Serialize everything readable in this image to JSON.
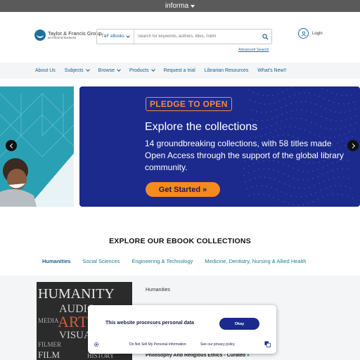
{
  "topbar": {
    "brand": "informa"
  },
  "header": {
    "logo_line1": "Taylor & Francis Group",
    "logo_line2": "an informa business",
    "search_scope": "T&F eBooks",
    "search_placeholder": "Search for keywords, authors, titles, ISBN",
    "advanced_search": "Advanced Search",
    "login": "Login"
  },
  "nav": {
    "items": [
      {
        "label": "About Us",
        "dropdown": false
      },
      {
        "label": "Subjects",
        "dropdown": true
      },
      {
        "label": "Browse",
        "dropdown": true
      },
      {
        "label": "Products",
        "dropdown": true
      },
      {
        "label": "Request a trial",
        "dropdown": false
      },
      {
        "label": "Librarian Resources",
        "dropdown": false
      },
      {
        "label": "What's New!!",
        "dropdown": false
      }
    ]
  },
  "hero": {
    "badge": "PLEDGE TO OPEN",
    "title": "Explore the collections",
    "body": "14 groundbreaking collections, with 58 titles made Open Access through the support of the global library community.",
    "cta": "Get Started »"
  },
  "collections": {
    "title": "EXPLORE OUR EBOOK COLLECTIONS",
    "tabs": [
      {
        "label": "Humanities",
        "active": true
      },
      {
        "label": "Social Sciences",
        "active": false
      },
      {
        "label": "Engineering & Technology",
        "active": false
      },
      {
        "label": "Medicine, Dentistry, Nursing & Allied Health",
        "active": false
      }
    ],
    "panel_category": "Humanities",
    "panel_item": "Philosophy And Religious Ethics - Curated",
    "panel_item_suffix": "»",
    "book_words": [
      "HUMANITY",
      "AUDIO",
      "ART",
      "VISUAL",
      "MEDIA",
      "FILMER",
      "FILM",
      "HISTORY"
    ]
  },
  "cookie": {
    "message": "This website processes personal data",
    "okay": "Okay",
    "do_not_sell": "Do Not Sell My Personal Information",
    "privacy": "See our privacy policy"
  },
  "colors": {
    "brand_blue": "#1b2a8c",
    "accent_orange": "#f58a1e",
    "teal": "#2aa0b4",
    "link_blue": "#1a5d8f"
  }
}
